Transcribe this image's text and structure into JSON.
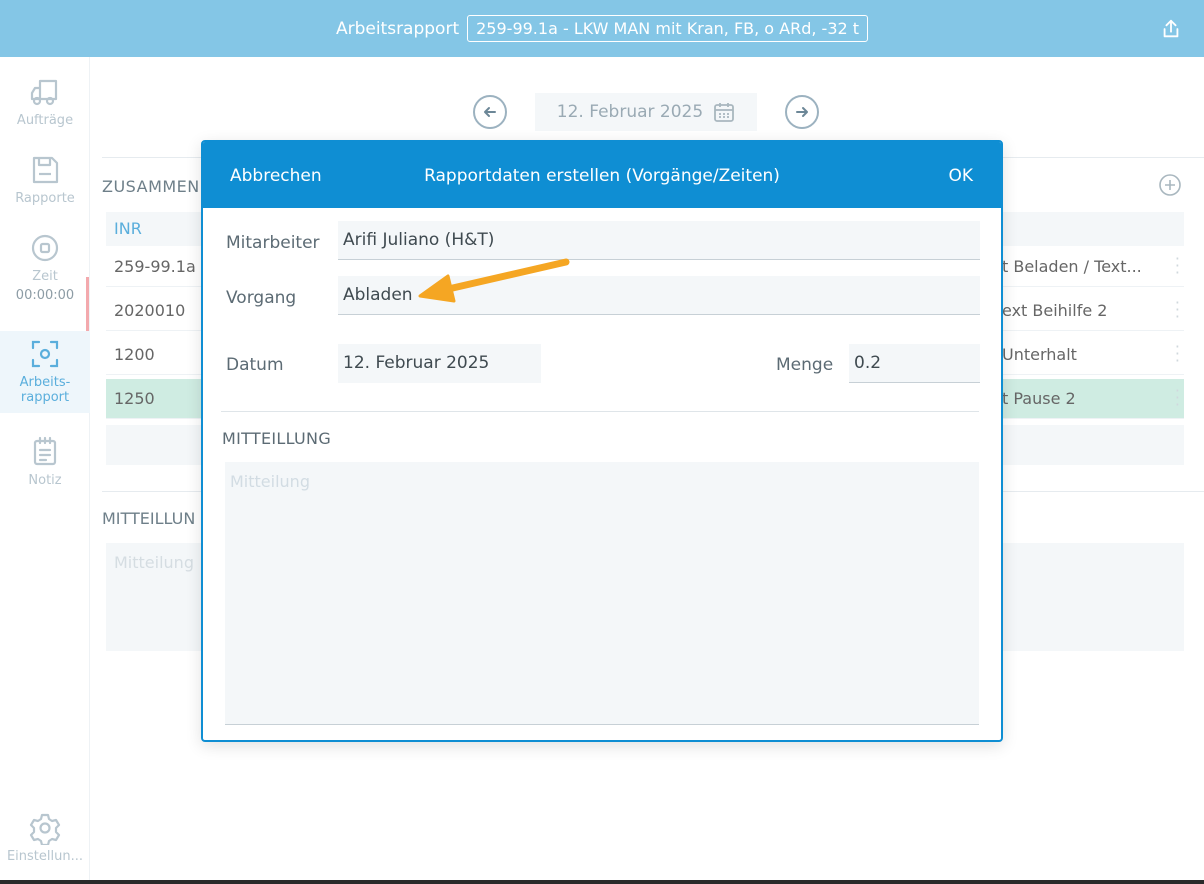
{
  "topbar": {
    "title": "Arbeitsrapport",
    "order": "259-99.1a - LKW MAN mit Kran, FB, o ARd, -32 t"
  },
  "sidebar": {
    "items": [
      {
        "label": "Aufträge"
      },
      {
        "label": "Rapporte"
      },
      {
        "label": "Zeit",
        "time": "00:00:00"
      },
      {
        "label": "Arbeits-",
        "label2": "rapport"
      },
      {
        "label": "Notiz"
      },
      {
        "label": "Einstellun..."
      }
    ]
  },
  "main": {
    "date": "12. Februar 2025",
    "section_title": "ZUSAMMEN",
    "table": {
      "header": "INR",
      "rows": [
        {
          "inr": "259-99.1a",
          "right": "t Beladen / Text..."
        },
        {
          "inr": "2020010",
          "right": "ext Beihilfe 2"
        },
        {
          "inr": "1200",
          "right": "Unterhalt"
        },
        {
          "inr": "1250",
          "right": "t Pause 2"
        }
      ]
    },
    "message_title": "MITTEILLUN",
    "message_placeholder": "Mitteilung"
  },
  "modal": {
    "cancel": "Abbrechen",
    "title": "Rapportdaten erstellen (Vorgänge/Zeiten)",
    "ok": "OK",
    "fields": {
      "mitarbeiter_label": "Mitarbeiter",
      "mitarbeiter_value": "Arifi Juliano (H&T)",
      "vorgang_label": "Vorgang",
      "vorgang_value": "Abladen",
      "datum_label": "Datum",
      "datum_value": "12. Februar 2025",
      "menge_label": "Menge",
      "menge_value": "0.2"
    },
    "message_title": "MITTEILLUNG",
    "message_placeholder": "Mitteilung"
  },
  "colors": {
    "topbar": "#84c6e6",
    "modal_header": "#0f8ed3",
    "highlight_row": "#cfece2",
    "annotation_arrow": "#f5a623"
  }
}
